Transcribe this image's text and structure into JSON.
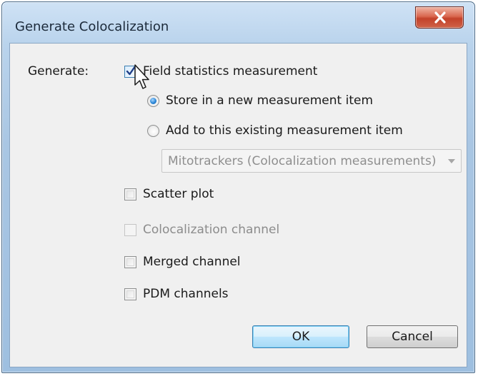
{
  "window": {
    "title": "Generate Colocalization"
  },
  "form": {
    "generate_label": "Generate:",
    "field_statistics": {
      "label": "Field statistics measurement",
      "checked": true
    },
    "store_new": {
      "label": "Store in a new measurement item",
      "selected": true
    },
    "add_existing": {
      "label": "Add to this existing measurement item",
      "selected": false
    },
    "existing_item_dropdown": {
      "value": "Mitotrackers (Colocalization measurements)",
      "enabled": false
    },
    "scatter_plot": {
      "label": "Scatter plot",
      "checked": false
    },
    "colocalization_channel": {
      "label": "Colocalization channel",
      "checked": false,
      "enabled": false
    },
    "merged_channel": {
      "label": "Merged channel",
      "checked": false
    },
    "pdm_channels": {
      "label": "PDM channels",
      "checked": false
    }
  },
  "buttons": {
    "ok": "OK",
    "cancel": "Cancel"
  },
  "colors": {
    "title_bar": "#b9d3ec",
    "close_button": "#c3422b",
    "dialog_body": "#f0f0f0",
    "check_accent": "#3c7fb1"
  },
  "icons": {
    "close": "close-icon",
    "check": "checkmark-icon",
    "dropdown": "chevron-down-icon",
    "cursor": "mouse-pointer-icon"
  }
}
